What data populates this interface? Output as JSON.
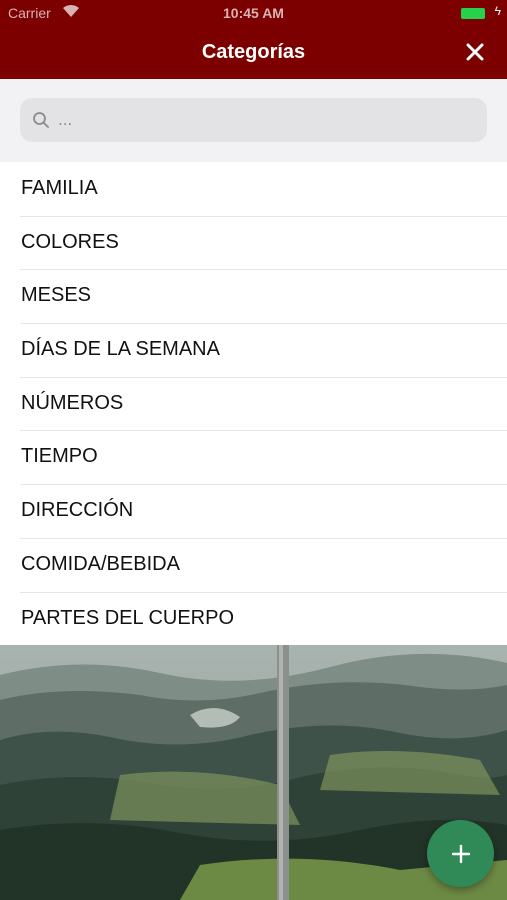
{
  "status_bar": {
    "carrier": "Carrier",
    "time": "10:45 AM",
    "battery_color": "#27d24a"
  },
  "nav": {
    "title": "Categorías",
    "close_icon": "close-icon",
    "background_color": "#7c0000"
  },
  "search": {
    "placeholder": "...",
    "value": "",
    "icon": "search-icon"
  },
  "categories": [
    {
      "label": "FAMILIA"
    },
    {
      "label": "COLORES"
    },
    {
      "label": "MESES"
    },
    {
      "label": "DÍAS DE LA SEMANA"
    },
    {
      "label": "NÚMEROS"
    },
    {
      "label": "TIEMPO"
    },
    {
      "label": "DIRECCIÓN"
    },
    {
      "label": "COMIDA/BEBIDA"
    },
    {
      "label": "PARTES DEL CUERPO"
    }
  ],
  "fab": {
    "icon": "plus-icon",
    "color": "#2f8a57"
  }
}
